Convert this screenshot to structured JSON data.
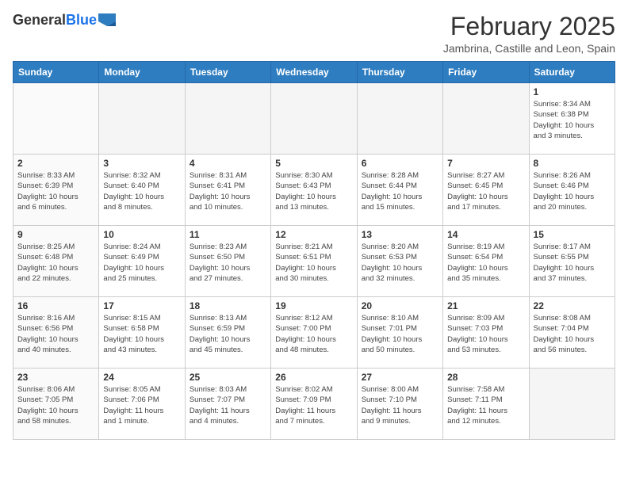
{
  "header": {
    "logo_general": "General",
    "logo_blue": "Blue",
    "month_title": "February 2025",
    "subtitle": "Jambrina, Castille and Leon, Spain"
  },
  "weekdays": [
    "Sunday",
    "Monday",
    "Tuesday",
    "Wednesday",
    "Thursday",
    "Friday",
    "Saturday"
  ],
  "weeks": [
    [
      {
        "day": "",
        "info": ""
      },
      {
        "day": "",
        "info": ""
      },
      {
        "day": "",
        "info": ""
      },
      {
        "day": "",
        "info": ""
      },
      {
        "day": "",
        "info": ""
      },
      {
        "day": "",
        "info": ""
      },
      {
        "day": "1",
        "info": "Sunrise: 8:34 AM\nSunset: 6:38 PM\nDaylight: 10 hours\nand 3 minutes."
      }
    ],
    [
      {
        "day": "2",
        "info": "Sunrise: 8:33 AM\nSunset: 6:39 PM\nDaylight: 10 hours\nand 6 minutes."
      },
      {
        "day": "3",
        "info": "Sunrise: 8:32 AM\nSunset: 6:40 PM\nDaylight: 10 hours\nand 8 minutes."
      },
      {
        "day": "4",
        "info": "Sunrise: 8:31 AM\nSunset: 6:41 PM\nDaylight: 10 hours\nand 10 minutes."
      },
      {
        "day": "5",
        "info": "Sunrise: 8:30 AM\nSunset: 6:43 PM\nDaylight: 10 hours\nand 13 minutes."
      },
      {
        "day": "6",
        "info": "Sunrise: 8:28 AM\nSunset: 6:44 PM\nDaylight: 10 hours\nand 15 minutes."
      },
      {
        "day": "7",
        "info": "Sunrise: 8:27 AM\nSunset: 6:45 PM\nDaylight: 10 hours\nand 17 minutes."
      },
      {
        "day": "8",
        "info": "Sunrise: 8:26 AM\nSunset: 6:46 PM\nDaylight: 10 hours\nand 20 minutes."
      }
    ],
    [
      {
        "day": "9",
        "info": "Sunrise: 8:25 AM\nSunset: 6:48 PM\nDaylight: 10 hours\nand 22 minutes."
      },
      {
        "day": "10",
        "info": "Sunrise: 8:24 AM\nSunset: 6:49 PM\nDaylight: 10 hours\nand 25 minutes."
      },
      {
        "day": "11",
        "info": "Sunrise: 8:23 AM\nSunset: 6:50 PM\nDaylight: 10 hours\nand 27 minutes."
      },
      {
        "day": "12",
        "info": "Sunrise: 8:21 AM\nSunset: 6:51 PM\nDaylight: 10 hours\nand 30 minutes."
      },
      {
        "day": "13",
        "info": "Sunrise: 8:20 AM\nSunset: 6:53 PM\nDaylight: 10 hours\nand 32 minutes."
      },
      {
        "day": "14",
        "info": "Sunrise: 8:19 AM\nSunset: 6:54 PM\nDaylight: 10 hours\nand 35 minutes."
      },
      {
        "day": "15",
        "info": "Sunrise: 8:17 AM\nSunset: 6:55 PM\nDaylight: 10 hours\nand 37 minutes."
      }
    ],
    [
      {
        "day": "16",
        "info": "Sunrise: 8:16 AM\nSunset: 6:56 PM\nDaylight: 10 hours\nand 40 minutes."
      },
      {
        "day": "17",
        "info": "Sunrise: 8:15 AM\nSunset: 6:58 PM\nDaylight: 10 hours\nand 43 minutes."
      },
      {
        "day": "18",
        "info": "Sunrise: 8:13 AM\nSunset: 6:59 PM\nDaylight: 10 hours\nand 45 minutes."
      },
      {
        "day": "19",
        "info": "Sunrise: 8:12 AM\nSunset: 7:00 PM\nDaylight: 10 hours\nand 48 minutes."
      },
      {
        "day": "20",
        "info": "Sunrise: 8:10 AM\nSunset: 7:01 PM\nDaylight: 10 hours\nand 50 minutes."
      },
      {
        "day": "21",
        "info": "Sunrise: 8:09 AM\nSunset: 7:03 PM\nDaylight: 10 hours\nand 53 minutes."
      },
      {
        "day": "22",
        "info": "Sunrise: 8:08 AM\nSunset: 7:04 PM\nDaylight: 10 hours\nand 56 minutes."
      }
    ],
    [
      {
        "day": "23",
        "info": "Sunrise: 8:06 AM\nSunset: 7:05 PM\nDaylight: 10 hours\nand 58 minutes."
      },
      {
        "day": "24",
        "info": "Sunrise: 8:05 AM\nSunset: 7:06 PM\nDaylight: 11 hours\nand 1 minute."
      },
      {
        "day": "25",
        "info": "Sunrise: 8:03 AM\nSunset: 7:07 PM\nDaylight: 11 hours\nand 4 minutes."
      },
      {
        "day": "26",
        "info": "Sunrise: 8:02 AM\nSunset: 7:09 PM\nDaylight: 11 hours\nand 7 minutes."
      },
      {
        "day": "27",
        "info": "Sunrise: 8:00 AM\nSunset: 7:10 PM\nDaylight: 11 hours\nand 9 minutes."
      },
      {
        "day": "28",
        "info": "Sunrise: 7:58 AM\nSunset: 7:11 PM\nDaylight: 11 hours\nand 12 minutes."
      },
      {
        "day": "",
        "info": ""
      }
    ]
  ]
}
